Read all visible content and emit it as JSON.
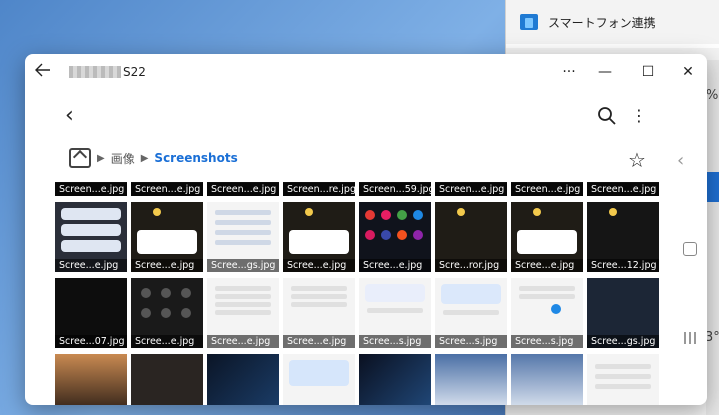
{
  "background_window": {
    "title": "スマートフォン連携",
    "fragment_right_1": "%",
    "fragment_right_2": "3°"
  },
  "window": {
    "back_icon": "arrow-left-icon",
    "device_suffix": "S22",
    "controls": {
      "more": "···",
      "minimize": "—",
      "maximize": "☐",
      "close": "✕"
    }
  },
  "toolbar": {
    "back": "‹",
    "more": "⋮"
  },
  "breadcrumb": {
    "folder": "画像",
    "current": "Screenshots"
  },
  "thumbnails": [
    {
      "label": "Screen...e.jpg"
    },
    {
      "label": "Screen...e.jpg"
    },
    {
      "label": "Screen...e.jpg"
    },
    {
      "label": "Screen...re.jpg"
    },
    {
      "label": "Screen...59.jpg"
    },
    {
      "label": "Screen...e.jpg"
    },
    {
      "label": "Screen...e.jpg"
    },
    {
      "label": "Screen...e.jpg"
    },
    {
      "label": "Scree...e.jpg"
    },
    {
      "label": "Scree...e.jpg"
    },
    {
      "label": "Scree...gs.jpg"
    },
    {
      "label": "Scree...e.jpg"
    },
    {
      "label": "Scree...e.jpg"
    },
    {
      "label": "Scre...ror.jpg"
    },
    {
      "label": "Scree...e.jpg"
    },
    {
      "label": "Scree...12.jpg"
    },
    {
      "label": "Scree...07.jpg"
    },
    {
      "label": "Scree...e.jpg"
    },
    {
      "label": "Scree...e.jpg"
    },
    {
      "label": "Scree...e.jpg"
    },
    {
      "label": "Scree...s.jpg"
    },
    {
      "label": "Scree...s.jpg"
    },
    {
      "label": "Scree...s.jpg"
    },
    {
      "label": "Scree...gs.jpg"
    }
  ]
}
